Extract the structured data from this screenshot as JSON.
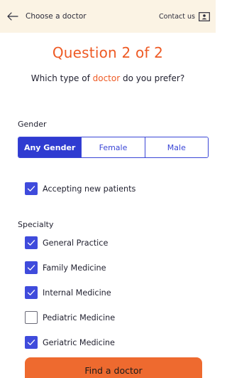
{
  "header": {
    "back_icon": "arrow-left-icon",
    "title": "Choose a doctor",
    "contact_label": "Contact us",
    "contact_icon": "contact-card-icon",
    "background": "#fbf3e4"
  },
  "question": {
    "title": "Question 2 of 2",
    "subtitle_before": "Which type of ",
    "subtitle_highlight": "doctor",
    "subtitle_after": " do you prefer?",
    "accent": "#ee5a24"
  },
  "gender": {
    "label": "Gender",
    "options": [
      {
        "label": "Any Gender",
        "selected": true
      },
      {
        "label": "Female",
        "selected": false
      },
      {
        "label": "Male",
        "selected": false
      }
    ]
  },
  "accepting": {
    "label": "Accepting new patients",
    "checked": true
  },
  "specialty": {
    "label": "Specialty",
    "items": [
      {
        "label": "General Practice",
        "checked": true
      },
      {
        "label": "Family Medicine",
        "checked": true
      },
      {
        "label": "Internal Medicine",
        "checked": true
      },
      {
        "label": "Pediatric Medicine",
        "checked": false
      },
      {
        "label": "Geriatric Medicine",
        "checked": true
      }
    ]
  },
  "find_button": {
    "label": "Find a doctor",
    "color": "#ee6a2f"
  },
  "colors": {
    "primary": "#3a46d6",
    "check": "#3f4bdc"
  }
}
